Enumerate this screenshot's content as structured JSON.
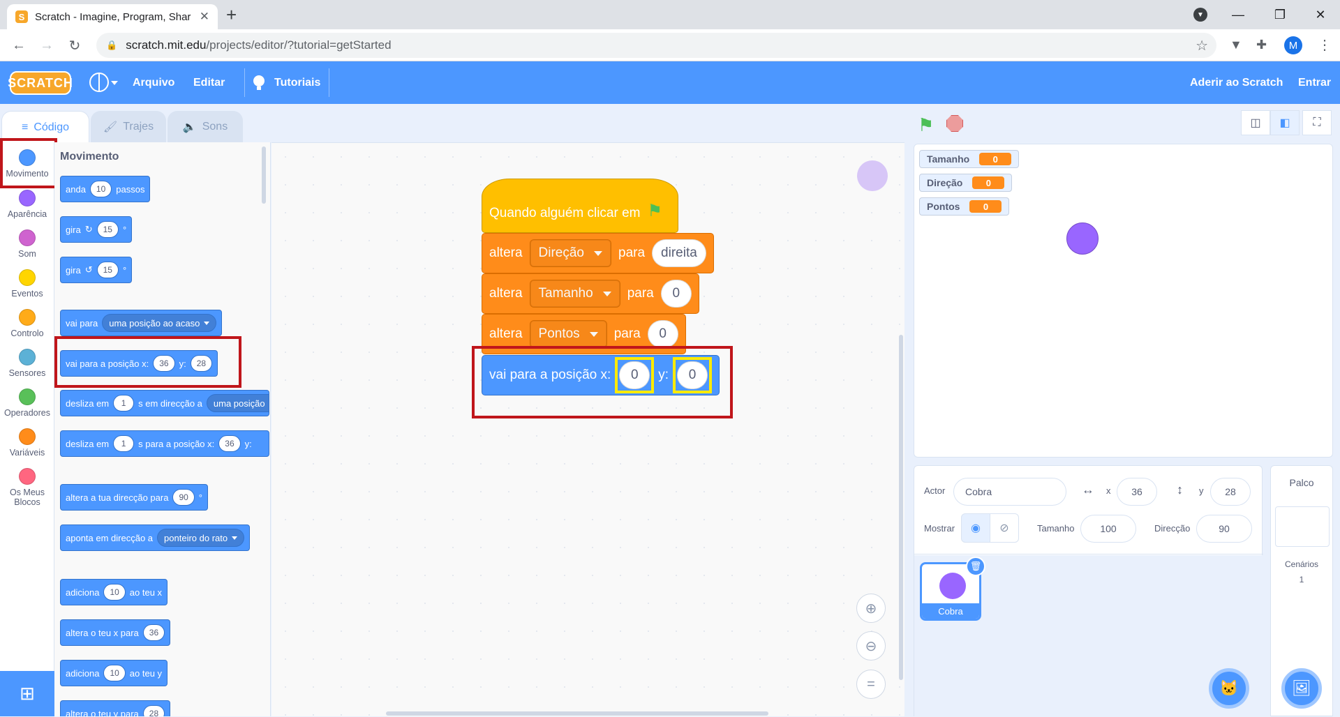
{
  "browser": {
    "tab_title": "Scratch - Imagine, Program, Shar",
    "url_host": "scratch.mit.edu",
    "url_path": "/projects/editor/?tutorial=getStarted",
    "profile_initial": "M"
  },
  "menubar": {
    "logo": "SCRATCH",
    "file": "Arquivo",
    "edit": "Editar",
    "tutorials": "Tutoriais",
    "join": "Aderir ao Scratch",
    "signin": "Entrar"
  },
  "editor_tabs": {
    "code": "Código",
    "costumes": "Trajes",
    "sounds": "Sons"
  },
  "categories": [
    {
      "label": "Movimento",
      "color": "#4c97ff"
    },
    {
      "label": "Aparência",
      "color": "#9966ff"
    },
    {
      "label": "Som",
      "color": "#cf63cf"
    },
    {
      "label": "Eventos",
      "color": "#ffd500"
    },
    {
      "label": "Controlo",
      "color": "#ffab19"
    },
    {
      "label": "Sensores",
      "color": "#5cb1d6"
    },
    {
      "label": "Operadores",
      "color": "#59c059"
    },
    {
      "label": "Variáveis",
      "color": "#ff8c1a"
    },
    {
      "label": "Os Meus Blocos",
      "color": "#ff6680"
    }
  ],
  "palette": {
    "title": "Movimento",
    "b1": {
      "a": "anda",
      "v": "10",
      "b": "passos"
    },
    "b2": {
      "a": "gira",
      "v": "15",
      "b": "°"
    },
    "b3": {
      "a": "gira",
      "v": "15",
      "b": "°"
    },
    "b4": {
      "a": "vai para",
      "dd": "uma posição ao acaso"
    },
    "b5": {
      "a": "vai para a posição x:",
      "v1": "36",
      "b": "y:",
      "v2": "28"
    },
    "b6": {
      "a": "desliza em",
      "v": "1",
      "b": "s em direcção a",
      "dd": "uma posição"
    },
    "b7": {
      "a": "desliza em",
      "v": "1",
      "b": "s para a posição x:",
      "v2": "36",
      "c": "y:"
    },
    "b8": {
      "a": "altera a tua direcção para",
      "v": "90",
      "b": "°"
    },
    "b9": {
      "a": "aponta em direcção a",
      "dd": "ponteiro do rato"
    },
    "b10": {
      "a": "adiciona",
      "v": "10",
      "b": "ao teu x"
    },
    "b11": {
      "a": "altera o teu x para",
      "v": "36"
    },
    "b12": {
      "a": "adiciona",
      "v": "10",
      "b": "ao teu y"
    },
    "b13": {
      "a": "altera o teu y para",
      "v": "28"
    }
  },
  "script": {
    "hat": "Quando alguém clicar em",
    "set1": {
      "a": "altera",
      "var": "Direção",
      "b": "para",
      "val": "direita"
    },
    "set2": {
      "a": "altera",
      "var": "Tamanho",
      "b": "para",
      "val": "0"
    },
    "set3": {
      "a": "altera",
      "var": "Pontos",
      "b": "para",
      "val": "0"
    },
    "goto": {
      "a": "vai para a posição x:",
      "x": "0",
      "b": "y:",
      "y": "0"
    }
  },
  "monitors": [
    {
      "name": "Tamanho",
      "value": "0"
    },
    {
      "name": "Direção",
      "value": "0"
    },
    {
      "name": "Pontos",
      "value": "0"
    }
  ],
  "sprite_info": {
    "actor_label": "Actor",
    "actor_name": "Cobra",
    "x_label": "x",
    "x": "36",
    "y_label": "y",
    "y": "28",
    "show_label": "Mostrar",
    "size_label": "Tamanho",
    "size": "100",
    "direction_label": "Direcção",
    "direction": "90"
  },
  "sprites": [
    {
      "name": "Cobra"
    }
  ],
  "stage_pane": {
    "title": "Palco",
    "backdrops_label": "Cenários",
    "backdrops_count": "1"
  },
  "colors": {
    "accent": "#4c97ff",
    "highlight_red": "#c0161b",
    "highlight_yellow": "#ffeb00"
  }
}
